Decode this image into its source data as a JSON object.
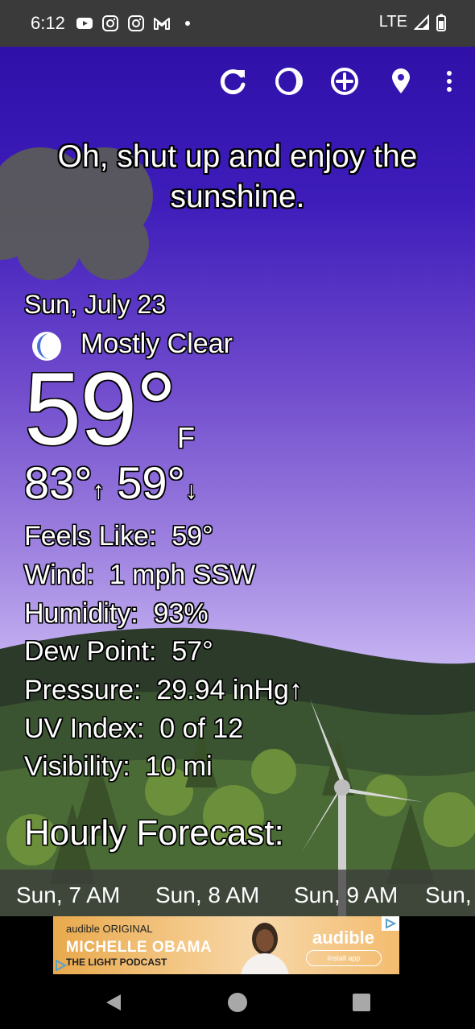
{
  "status_bar": {
    "time": "6:12",
    "left_icons": [
      "youtube-icon",
      "instagram-icon",
      "instagram-icon",
      "gmail-icon",
      "dot-icon"
    ],
    "network": "LTE",
    "right_icons": [
      "signal-icon",
      "battery-icon"
    ]
  },
  "toolbar": {
    "icons": [
      "refresh-icon",
      "theme-icon",
      "add-location-icon",
      "location-pin-icon",
      "overflow-menu-icon"
    ]
  },
  "quote": "Oh, shut up and enjoy the sunshine.",
  "current": {
    "date": "Sun, July 23",
    "condition_icon": "moon-icon",
    "condition": "Mostly Clear",
    "temperature": "59°",
    "unit": "F",
    "high": "83°",
    "low": "59°",
    "high_arrow": "↑",
    "low_arrow": "↓"
  },
  "details": [
    {
      "label": "Feels Like:",
      "value": "59°"
    },
    {
      "label": "Wind:",
      "value": "1 mph SSW"
    },
    {
      "label": "Humidity:",
      "value": "93%"
    },
    {
      "label": "Dew Point:",
      "value": "57°"
    },
    {
      "label": "Pressure:",
      "value": "29.94 inHg↑"
    },
    {
      "label": "UV Index:",
      "value": "0 of 12"
    },
    {
      "label": "Visibility:",
      "value": "10 mi"
    }
  ],
  "hourly": {
    "title": "Hourly Forecast:",
    "items": [
      "Sun, 7 AM",
      "Sun, 8 AM",
      "Sun, 9 AM",
      "Sun,"
    ]
  },
  "ad": {
    "line1": "audible ORIGINAL",
    "line2": "MICHELLE OBAMA",
    "line3": "THE LIGHT PODCAST",
    "brand": "audible",
    "cta": "Install app"
  },
  "nav": {
    "icons": [
      "back-icon",
      "home-icon",
      "recents-icon"
    ]
  },
  "colors": {
    "sky_top": "#2f10a8",
    "sky_bottom": "#d9cdf8",
    "status_bar": "#3a3a3a",
    "moon": "#4a72d8"
  }
}
